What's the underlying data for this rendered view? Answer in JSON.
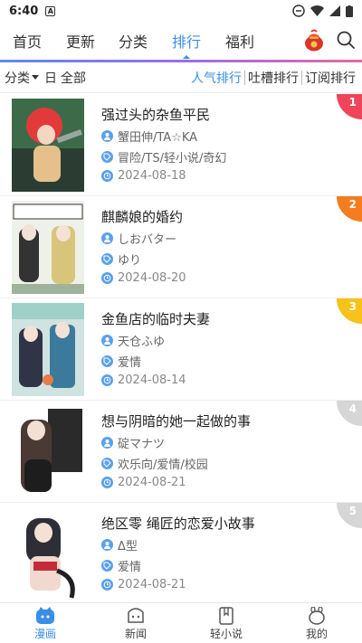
{
  "status": {
    "time": "6:40",
    "app_icon_letter": "A"
  },
  "topnav": {
    "tabs": [
      {
        "id": "home",
        "label": "首页"
      },
      {
        "id": "update",
        "label": "更新"
      },
      {
        "id": "category",
        "label": "分类"
      },
      {
        "id": "ranking",
        "label": "排行",
        "active": true
      },
      {
        "id": "welfare",
        "label": "福利"
      }
    ],
    "accent": "#3a8ee6"
  },
  "filter": {
    "category_label": "分类",
    "period": "日",
    "scope": "全部",
    "sort_options": [
      {
        "label": "人气排行",
        "active": true
      },
      {
        "label": "吐槽排行"
      },
      {
        "label": "订阅排行"
      }
    ]
  },
  "items": [
    {
      "rank": "1",
      "rank_color": "#f0445a",
      "title": "强过头的杂鱼平民",
      "author": "蟹田伸/TA☆KA",
      "tags": "冒险/TS/轻小说/奇幻",
      "date": "2024-08-18"
    },
    {
      "rank": "2",
      "rank_color": "#f57c1f",
      "title": "麒麟娘的婚约",
      "author": "しおバター",
      "tags": "ゆり",
      "date": "2024-08-20"
    },
    {
      "rank": "3",
      "rank_color": "#f7c21a",
      "title": "金鱼店的临时夫妻",
      "author": "天仓ふゆ",
      "tags": "爱情",
      "date": "2024-08-14"
    },
    {
      "rank": "4",
      "rank_color": "#d6d6d6",
      "title": "想与阴暗的她一起做的事",
      "author": "碇マナツ",
      "tags": "欢乐向/爱情/校园",
      "date": "2024-08-21"
    },
    {
      "rank": "5",
      "rank_color": "#d6d6d6",
      "title": "绝区零 绳匠的恋爱小故事",
      "author": "Δ型",
      "tags": "爱情",
      "date": "2024-08-21"
    }
  ],
  "bottomnav": [
    {
      "label": "漫画",
      "active": true
    },
    {
      "label": "新闻"
    },
    {
      "label": "轻小说"
    },
    {
      "label": "我的"
    }
  ]
}
